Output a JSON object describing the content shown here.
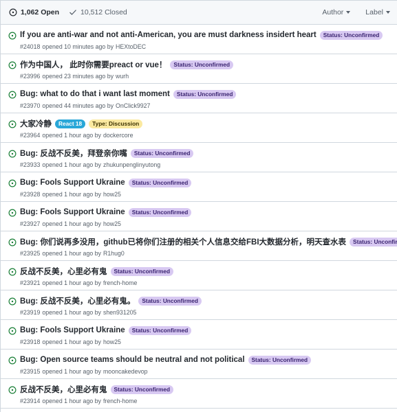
{
  "header": {
    "open_count": "1,062 Open",
    "closed_count": "10,512 Closed",
    "filters": [
      "Author",
      "Label"
    ]
  },
  "colors": {
    "open_icon": "#1a7f37",
    "status_unconfirmed_bg": "#d8c9f2",
    "status_unconfirmed_text": "#3a2470",
    "react18_bg": "#29a7d8",
    "react18_text": "#ffffff",
    "discussion_bg": "#fbe9a0",
    "discussion_text": "#3d3200"
  },
  "issues": [
    {
      "title": "If you are anti-war and not anti-American, you are must darkness insidert heart",
      "labels": [
        {
          "text": "Status: Unconfirmed",
          "kind": "unconfirmed"
        }
      ],
      "number": "#24018",
      "opened": "opened 10 minutes ago by",
      "author": "HEXtoDEC"
    },
    {
      "title": "作为中国人， 此时你需要preact or vue！",
      "labels": [
        {
          "text": "Status: Unconfirmed",
          "kind": "unconfirmed"
        }
      ],
      "number": "#23996",
      "opened": "opened 23 minutes ago by",
      "author": "wurh"
    },
    {
      "title": "Bug: what to do that i want last moment",
      "labels": [
        {
          "text": "Status: Unconfirmed",
          "kind": "unconfirmed"
        }
      ],
      "number": "#23970",
      "opened": "opened 44 minutes ago by",
      "author": "OnClick9927"
    },
    {
      "title": "大家冷静",
      "labels": [
        {
          "text": "React 18",
          "kind": "react18"
        },
        {
          "text": "Type: Discussion",
          "kind": "discussion"
        }
      ],
      "number": "#23964",
      "opened": "opened 1 hour ago by",
      "author": "dockercore"
    },
    {
      "title": "Bug: 反战不反美，拜登亲你嘴",
      "labels": [
        {
          "text": "Status: Unconfirmed",
          "kind": "unconfirmed"
        }
      ],
      "number": "#23933",
      "opened": "opened 1 hour ago by",
      "author": "zhukunpenglinyutong"
    },
    {
      "title": "Bug: Fools Support Ukraine",
      "labels": [
        {
          "text": "Status: Unconfirmed",
          "kind": "unconfirmed"
        }
      ],
      "number": "#23928",
      "opened": "opened 1 hour ago by",
      "author": "how25"
    },
    {
      "title": "Bug: Fools Support Ukraine",
      "labels": [
        {
          "text": "Status: Unconfirmed",
          "kind": "unconfirmed"
        }
      ],
      "number": "#23927",
      "opened": "opened 1 hour ago by",
      "author": "how25"
    },
    {
      "title": "Bug: 你们说再多没用，github已将你们注册的相关个人信息交给FBI大数据分析，明天查水表",
      "labels": [
        {
          "text": "Status: Unconfirmed",
          "kind": "unconfirmed"
        }
      ],
      "number": "#23925",
      "opened": "opened 1 hour ago by",
      "author": "R1hug0"
    },
    {
      "title": "反战不反美，心里必有鬼",
      "labels": [
        {
          "text": "Status: Unconfirmed",
          "kind": "unconfirmed"
        }
      ],
      "number": "#23921",
      "opened": "opened 1 hour ago by",
      "author": "french-home"
    },
    {
      "title": "Bug: 反战不反美，心里必有鬼。",
      "labels": [
        {
          "text": "Status: Unconfirmed",
          "kind": "unconfirmed"
        }
      ],
      "number": "#23919",
      "opened": "opened 1 hour ago by",
      "author": "shen931205"
    },
    {
      "title": "Bug: Fools Support Ukraine",
      "labels": [
        {
          "text": "Status: Unconfirmed",
          "kind": "unconfirmed"
        }
      ],
      "number": "#23918",
      "opened": "opened 1 hour ago by",
      "author": "how25"
    },
    {
      "title": "Bug: Open source teams should be neutral and not political",
      "labels": [
        {
          "text": "Status: Unconfirmed",
          "kind": "unconfirmed"
        }
      ],
      "number": "#23915",
      "opened": "opened 1 hour ago by",
      "author": "mooncakedevop"
    },
    {
      "title": "反战不反美，心里必有鬼",
      "labels": [
        {
          "text": "Status: Unconfirmed",
          "kind": "unconfirmed"
        }
      ],
      "number": "#23914",
      "opened": "opened 1 hour ago by",
      "author": "french-home"
    }
  ]
}
